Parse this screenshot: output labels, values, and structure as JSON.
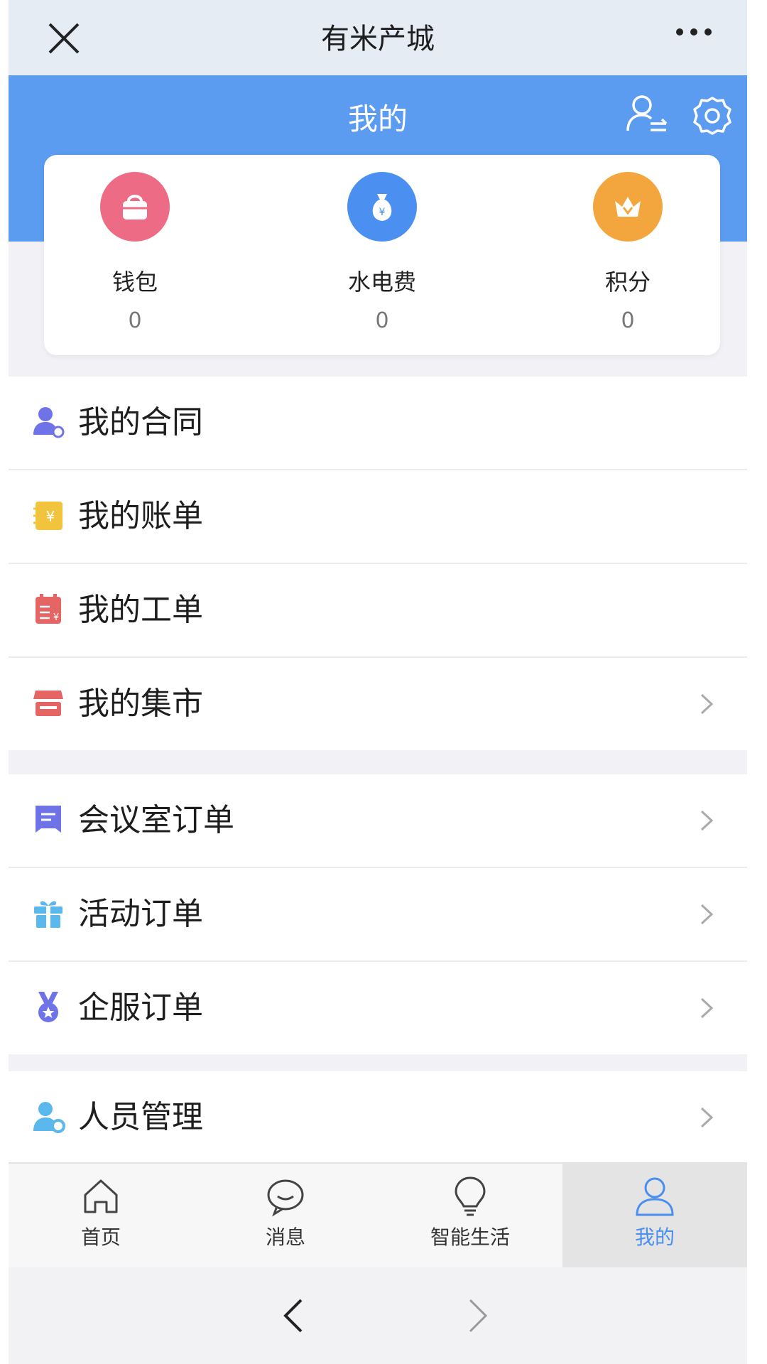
{
  "titlebar": {
    "title": "有米产城"
  },
  "header": {
    "title": "我的"
  },
  "stats": [
    {
      "label": "钱包",
      "value": "0",
      "icon": "wallet-icon",
      "color": "#ee6b86"
    },
    {
      "label": "水电费",
      "value": "0",
      "icon": "money-bag-icon",
      "color": "#4b8ff0"
    },
    {
      "label": "积分",
      "value": "0",
      "icon": "crown-icon",
      "color": "#f3a63e"
    }
  ],
  "menu_group1": [
    {
      "label": "我的合同",
      "icon": "contract-user-icon",
      "chevron": false
    },
    {
      "label": "我的账单",
      "icon": "bill-icon",
      "chevron": false
    },
    {
      "label": "我的工单",
      "icon": "work-order-icon",
      "chevron": false
    },
    {
      "label": "我的集市",
      "icon": "market-icon",
      "chevron": true
    }
  ],
  "menu_group2": [
    {
      "label": "会议室订单",
      "icon": "meeting-room-icon",
      "chevron": true
    },
    {
      "label": "活动订单",
      "icon": "gift-icon",
      "chevron": true
    },
    {
      "label": "企服订单",
      "icon": "medal-icon",
      "chevron": true
    }
  ],
  "menu_group3": [
    {
      "label": "人员管理",
      "icon": "people-manage-icon",
      "chevron": true
    }
  ],
  "tabs": [
    {
      "label": "首页",
      "icon": "home-icon",
      "active": false
    },
    {
      "label": "消息",
      "icon": "message-icon",
      "active": false
    },
    {
      "label": "智能生活",
      "icon": "bulb-icon",
      "active": false
    },
    {
      "label": "我的",
      "icon": "user-icon",
      "active": true
    }
  ],
  "colors": {
    "header_blue": "#5b9cf0",
    "active_tab": "#4a8ef0"
  }
}
